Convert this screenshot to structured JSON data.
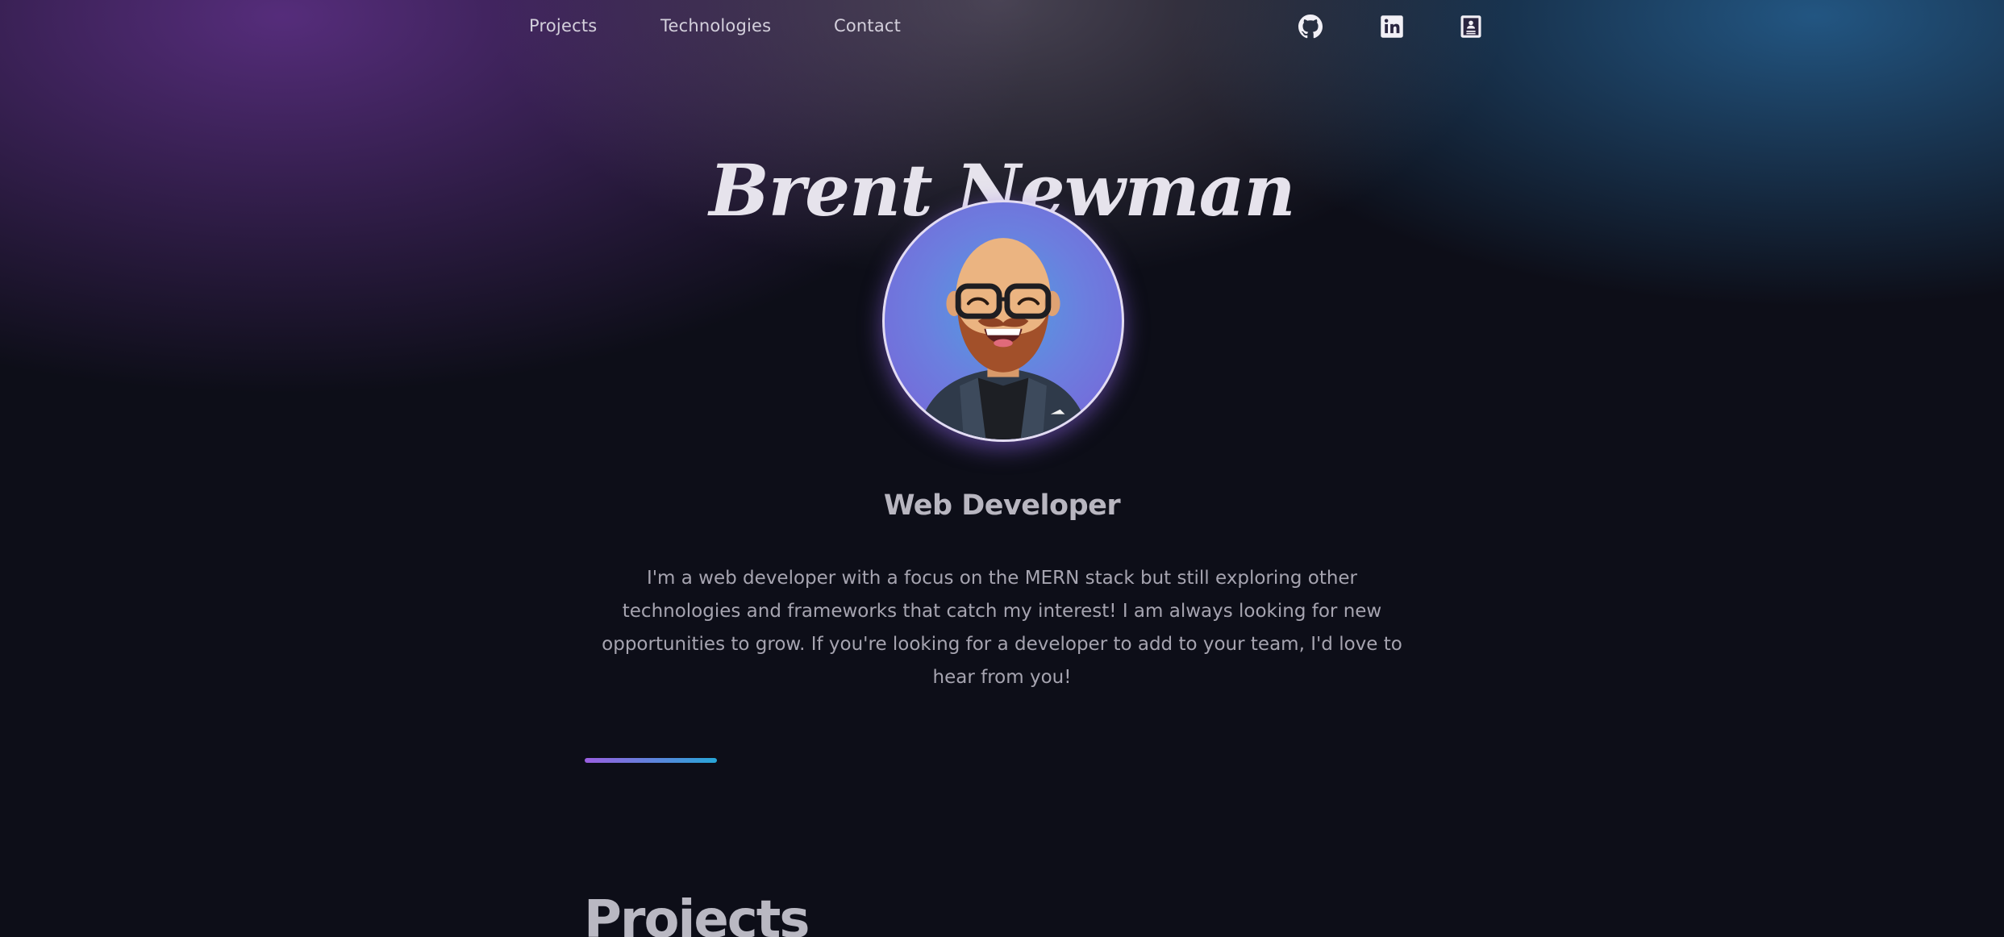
{
  "nav": {
    "links": [
      {
        "label": "Projects"
      },
      {
        "label": "Technologies"
      },
      {
        "label": "Contact"
      }
    ],
    "icons": [
      "github-icon",
      "linkedin-icon",
      "resume-icon"
    ]
  },
  "hero": {
    "name": "Brent Newman",
    "avatar_icon": "avatar-illustration",
    "role": "Web Developer",
    "bio": "I'm a web developer with a focus on the MERN stack but still exploring other technologies and frameworks that catch my interest! I am always looking for new opportunities to grow. If you're looking for a developer to add to your team, I'd love to hear from you!"
  },
  "projects_section": {
    "title": "Projects"
  },
  "colors": {
    "accent_purple": "#9a5fe0",
    "accent_blue": "#27a6d8",
    "background": "#0d0e18"
  }
}
